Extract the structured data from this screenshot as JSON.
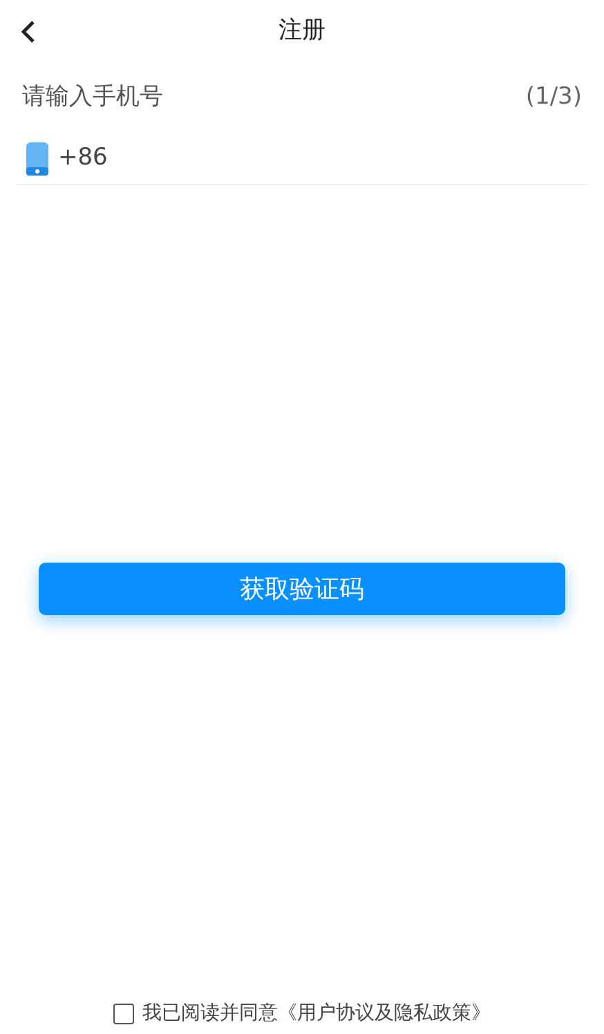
{
  "header": {
    "title": "注册"
  },
  "form": {
    "label": "请输入手机号",
    "step": "(1/3)",
    "country_code": "+86"
  },
  "submit": {
    "label": "获取验证码"
  },
  "agreement": {
    "checked": false,
    "text": "我已阅读并同意《用户协议及隐私政策》"
  }
}
